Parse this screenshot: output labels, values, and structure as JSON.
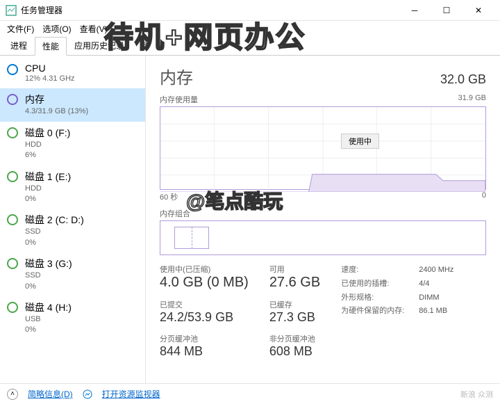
{
  "window": {
    "title": "任务管理器"
  },
  "menu": {
    "file": "文件(F)",
    "options": "选项(O)",
    "view": "查看(V)"
  },
  "tabs": {
    "processes": "进程",
    "performance": "性能",
    "apphistory": "应用历史记录",
    "startup": "启"
  },
  "sidebar": {
    "cpu": {
      "title": "CPU",
      "sub": "12%  4.31 GHz"
    },
    "mem": {
      "title": "内存",
      "sub": "4.3/31.9 GB (13%)"
    },
    "disk0": {
      "title": "磁盘 0 (F:)",
      "sub": "HDD\n6%"
    },
    "disk1": {
      "title": "磁盘 1 (E:)",
      "sub": "HDD\n0%"
    },
    "disk2": {
      "title": "磁盘 2 (C: D:)",
      "sub": "SSD\n0%"
    },
    "disk3": {
      "title": "磁盘 3 (G:)",
      "sub": "SSD\n0%"
    },
    "disk4": {
      "title": "磁盘 4 (H:)",
      "sub": "USB\n0%"
    }
  },
  "detail": {
    "title": "内存",
    "total": "32.0 GB",
    "chartLabel": "内存使用量",
    "chartMax": "31.9 GB",
    "badge": "使用中",
    "axisLeft": "60 秒",
    "axisRight": "0",
    "compLabel": "内存组合",
    "stats": {
      "inuse": {
        "label": "使用中(已压缩)",
        "value": "4.0 GB (0 MB)"
      },
      "avail": {
        "label": "可用",
        "value": "27.6 GB"
      },
      "commit": {
        "label": "已提交",
        "value": "24.2/53.9 GB"
      },
      "cached": {
        "label": "已缓存",
        "value": "27.3 GB"
      },
      "paged": {
        "label": "分页缓冲池",
        "value": "844 MB"
      },
      "nonpaged": {
        "label": "非分页缓冲池",
        "value": "608 MB"
      }
    },
    "info": {
      "speed": {
        "k": "速度:",
        "v": "2400 MHz"
      },
      "slots": {
        "k": "已使用的插槽:",
        "v": "4/4"
      },
      "form": {
        "k": "外形规格:",
        "v": "DIMM"
      },
      "reserved": {
        "k": "为硬件保留的内存:",
        "v": "86.1 MB"
      }
    }
  },
  "bottom": {
    "brief": "简略信息(D)",
    "resmon": "打开资源监视器"
  },
  "overlay": {
    "main": "待机+网页办公",
    "attr": "@笔点酷玩"
  },
  "watermark": "新浪 众测",
  "chart_data": {
    "type": "area",
    "title": "内存使用量",
    "ylabel": "GB",
    "ylim": [
      0,
      31.9
    ],
    "x": [
      60,
      55,
      50,
      45,
      40,
      35,
      30,
      28,
      25,
      20,
      15,
      10,
      8,
      5,
      0
    ],
    "values": [
      0,
      0,
      0,
      0,
      0,
      0,
      0,
      6.5,
      6.5,
      6.5,
      6.5,
      6.5,
      4.3,
      4.3,
      4.3
    ]
  }
}
